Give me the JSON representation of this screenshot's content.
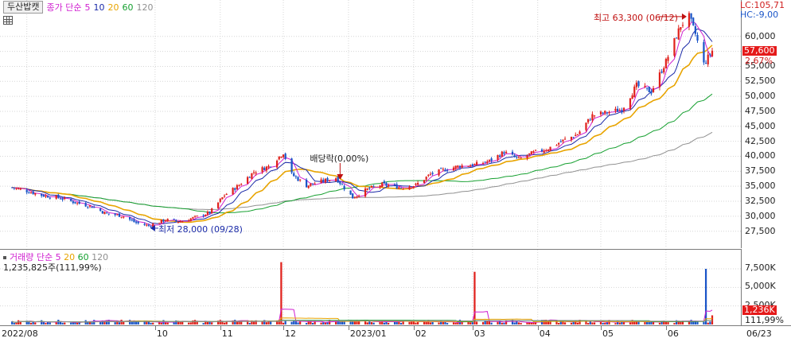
{
  "legend": {
    "stock_name": "두산밥캣",
    "ma_label": "종가 단순",
    "ma_periods": [
      "5",
      "10",
      "20",
      "60",
      "120"
    ],
    "ma_colors": [
      "#d020d0",
      "#1b2aa8",
      "#e8a400",
      "#16a030",
      "#909090"
    ]
  },
  "volume_legend": {
    "label": "거래량 단순",
    "ma_periods": [
      "5",
      "20",
      "60",
      "120"
    ],
    "value_text": "1,235,825주(111,99%)"
  },
  "right_axis": {
    "lc_text": "LC:105,71",
    "hc_text": "HC:-9,00",
    "current_price_badge": "57,600",
    "change_text": "2,67%",
    "price_ticks": [
      "60,000",
      "57,500",
      "55,000",
      "52,500",
      "50,000",
      "47,500",
      "45,000",
      "42,500",
      "40,000",
      "37,500",
      "35,000",
      "32,500",
      "30,000",
      "27,500"
    ],
    "volume_ticks": [
      "7,500K",
      "5,000K",
      "2,500K"
    ],
    "volume_badge": "1,236K",
    "volume_change": "111,99%"
  },
  "annotations": {
    "high": "최고 63,300 (06/12)",
    "low": "최저 28,000 (09/28)",
    "dividend": "배당락(0,00%)"
  },
  "x_axis": {
    "labels": [
      "2022/08",
      "10",
      "11",
      "12",
      "2023/01",
      "02",
      "03",
      "04",
      "05",
      "06",
      "06/23"
    ]
  },
  "colors": {
    "up": "#e0211c",
    "down": "#1a55c8",
    "grid": "#d6d6d6"
  },
  "chart_data": [
    {
      "type": "candlestick",
      "title": "",
      "xlabel": "",
      "ylabel": "",
      "x_range": [
        "2022/07",
        "2023/06/23"
      ],
      "ylim": [
        26000,
        64500
      ],
      "approx_close_series": [
        {
          "date": "2022/07/25",
          "close": 34800
        },
        {
          "date": "2022/08/01",
          "close": 34200
        },
        {
          "date": "2022/08/08",
          "close": 33500
        },
        {
          "date": "2022/08/16",
          "close": 33100
        },
        {
          "date": "2022/08/23",
          "close": 32400
        },
        {
          "date": "2022/09/01",
          "close": 31600
        },
        {
          "date": "2022/09/08",
          "close": 30400
        },
        {
          "date": "2022/09/15",
          "close": 30100
        },
        {
          "date": "2022/09/22",
          "close": 28900
        },
        {
          "date": "2022/09/28",
          "close": 28400
        },
        {
          "date": "2022/10/06",
          "close": 29400
        },
        {
          "date": "2022/10/13",
          "close": 29100
        },
        {
          "date": "2022/10/20",
          "close": 29800
        },
        {
          "date": "2022/10/27",
          "close": 30600
        },
        {
          "date": "2022/11/03",
          "close": 33500
        },
        {
          "date": "2022/11/10",
          "close": 35200
        },
        {
          "date": "2022/11/17",
          "close": 37400
        },
        {
          "date": "2022/11/24",
          "close": 38300
        },
        {
          "date": "2022/12/01",
          "close": 40600
        },
        {
          "date": "2022/12/05",
          "close": 37000
        },
        {
          "date": "2022/12/12",
          "close": 35100
        },
        {
          "date": "2022/12/19",
          "close": 35800
        },
        {
          "date": "2022/12/26",
          "close": 36400
        },
        {
          "date": "2023/01/03",
          "close": 33100
        },
        {
          "date": "2023/01/10",
          "close": 34500
        },
        {
          "date": "2023/01/17",
          "close": 35300
        },
        {
          "date": "2023/01/26",
          "close": 34800
        },
        {
          "date": "2023/02/02",
          "close": 35200
        },
        {
          "date": "2023/02/09",
          "close": 37000
        },
        {
          "date": "2023/02/16",
          "close": 37800
        },
        {
          "date": "2023/02/23",
          "close": 38400
        },
        {
          "date": "2023/03/02",
          "close": 38600
        },
        {
          "date": "2023/03/09",
          "close": 39200
        },
        {
          "date": "2023/03/16",
          "close": 40700
        },
        {
          "date": "2023/03/23",
          "close": 39500
        },
        {
          "date": "2023/03/30",
          "close": 40600
        },
        {
          "date": "2023/04/06",
          "close": 41300
        },
        {
          "date": "2023/04/13",
          "close": 42600
        },
        {
          "date": "2023/04/20",
          "close": 43700
        },
        {
          "date": "2023/04/27",
          "close": 46800
        },
        {
          "date": "2023/05/04",
          "close": 47300
        },
        {
          "date": "2023/05/11",
          "close": 47800
        },
        {
          "date": "2023/05/18",
          "close": 51800
        },
        {
          "date": "2023/05/25",
          "close": 50800
        },
        {
          "date": "2023/06/01",
          "close": 55800
        },
        {
          "date": "2023/06/08",
          "close": 61800
        },
        {
          "date": "2023/06/12",
          "close": 63300
        },
        {
          "date": "2023/06/15",
          "close": 60400
        },
        {
          "date": "2023/06/19",
          "close": 55400
        },
        {
          "date": "2023/06/23",
          "close": 57600
        }
      ]
    },
    {
      "type": "bar",
      "title": "",
      "xlabel": "",
      "ylabel": "",
      "ylim": [
        0,
        9000
      ],
      "series": [
        {
          "name": "거래량",
          "approx_spikes_k": [
            {
              "date": "2022/11/30",
              "value": 8400
            },
            {
              "date": "2023/03/02",
              "value": 7100
            },
            {
              "date": "2023/06/20",
              "value": 7500
            },
            {
              "date": "2023/06/23",
              "value": 1236
            }
          ]
        }
      ]
    }
  ]
}
